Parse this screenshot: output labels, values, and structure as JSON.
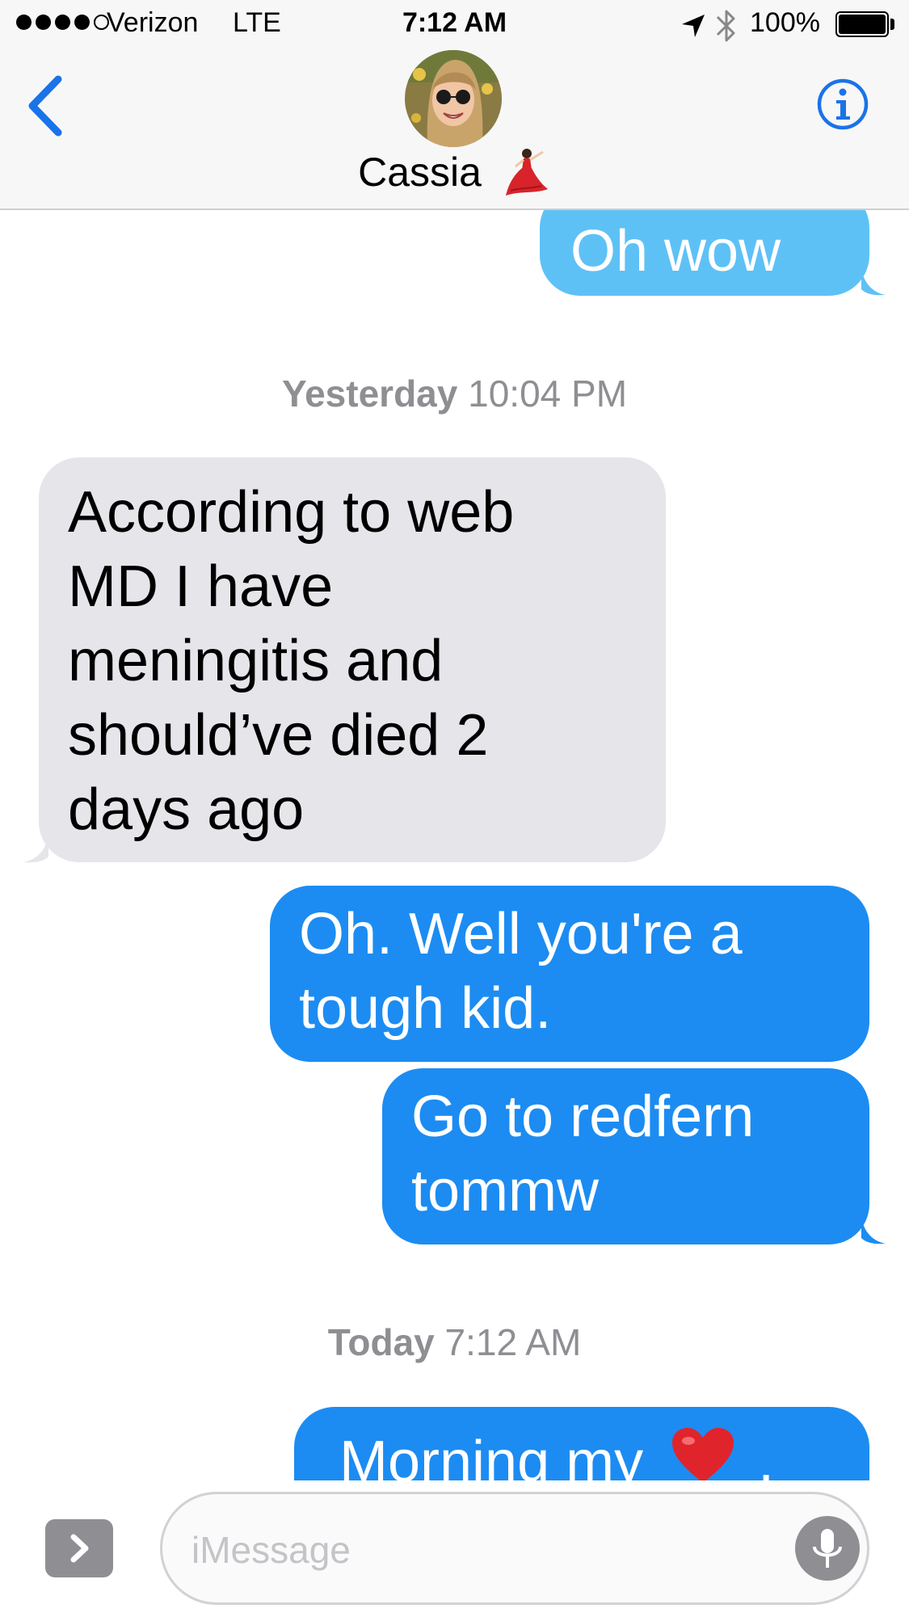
{
  "status_bar": {
    "carrier": "Verizon",
    "network": "LTE",
    "time": "7:12 AM",
    "battery": "100%",
    "signal_bars_filled": 4,
    "signal_bars_total": 5,
    "battery_level": 1.0
  },
  "header": {
    "contact_name": "Cassia",
    "back_icon": "chevron-left-icon",
    "info_icon": "info-icon",
    "name_emoji": "dancer-icon"
  },
  "conversation": {
    "msg_oh_wow": "Oh wow",
    "ts_yesterday_day": "Yesterday",
    "ts_yesterday_time": "10:04 PM",
    "msg_webmd_lines": [
      "According to web",
      "MD I have",
      "meningitis and",
      "should’ve died 2",
      "days ago"
    ],
    "msg_tough_lines": [
      "Oh. Well you're a",
      "tough kid."
    ],
    "msg_redfern_lines": [
      "Go to redfern",
      "tommw"
    ],
    "ts_today_day": "Today",
    "ts_today_time": "7:12 AM",
    "msg_morning": "Morning my",
    "msg_morning_emoji": "heart-icon"
  },
  "input_bar": {
    "placeholder": "iMessage",
    "value": "",
    "apps_icon": "chevron-right-icon",
    "mic_icon": "microphone-icon"
  },
  "colors": {
    "accent": "#1a73e8",
    "sent_bubble": "#1c8cf2",
    "sent_bubble_faded": "#5ec1f6",
    "received_bubble": "#e5e5ea",
    "timestamp_text": "#8e8e93"
  }
}
